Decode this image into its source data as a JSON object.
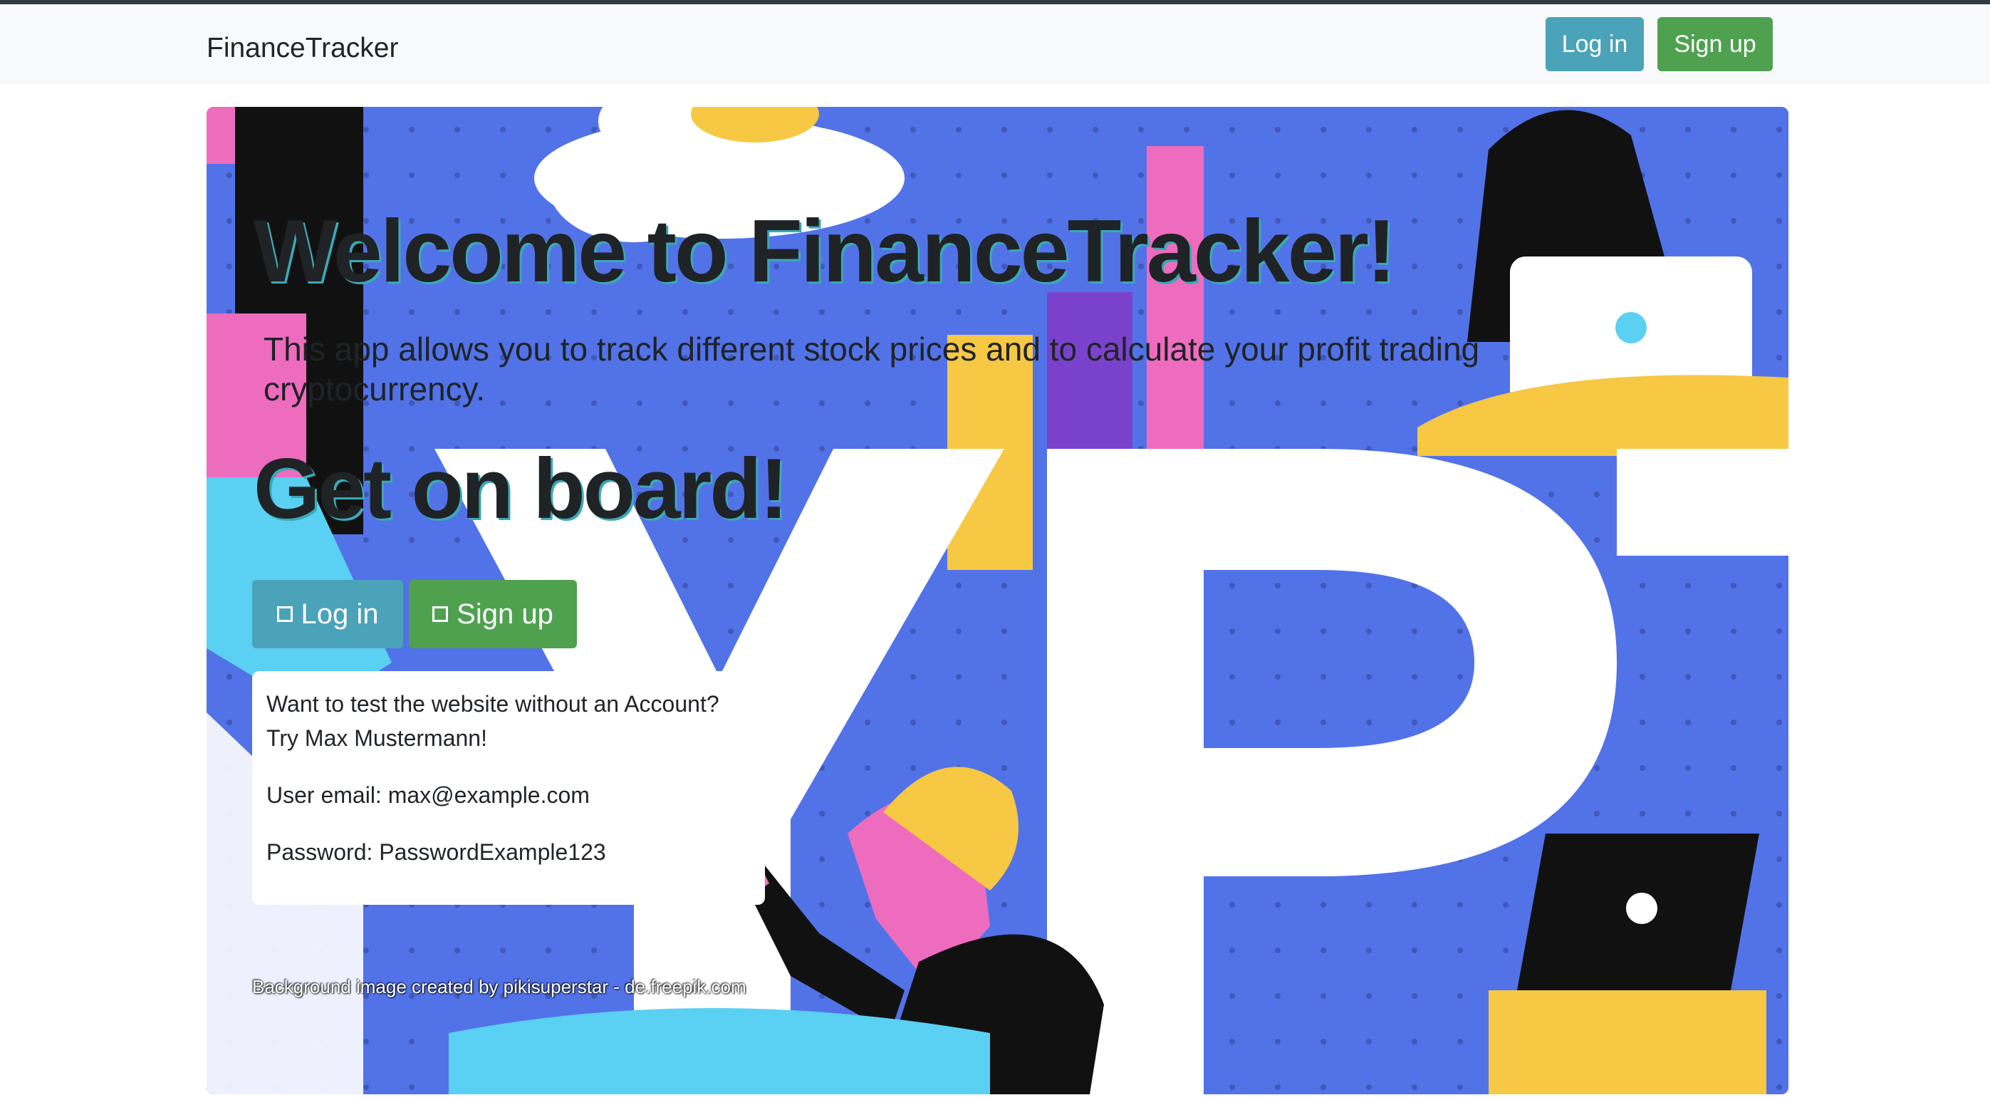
{
  "navbar": {
    "brand": "FinanceTracker",
    "login_label": "Log in",
    "signup_label": "Sign up"
  },
  "hero": {
    "title": "Welcome to FinanceTracker!",
    "lead": "This app allows you to track different stock prices and to calculate your profit trading cryptocurrency.",
    "subtitle": "Get on board!",
    "login_label": "Log in",
    "signup_label": "Sign up",
    "login_icon": "square-icon",
    "signup_icon": "square-icon"
  },
  "demo": {
    "line1": "Want to test the website without an Account?",
    "line2": "Try Max Mustermann!",
    "email": "User email: max@example.com",
    "password": "Password: PasswordExample123"
  },
  "credit": "Background image created by pikisuperstar - de.freepik.com",
  "colors": {
    "info": "#4aa3b8",
    "success": "#4fa150",
    "hero_blue": "#5272e8",
    "navbar_bg": "#f8f9fa"
  }
}
